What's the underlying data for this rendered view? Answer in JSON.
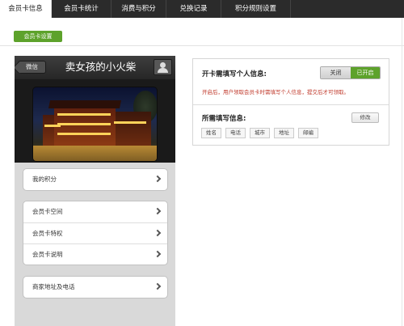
{
  "nav": {
    "tabs": [
      {
        "label": "会员卡信息",
        "active": true
      },
      {
        "label": "会员卡统计"
      },
      {
        "label": "消费与积分"
      },
      {
        "label": "兑换记录"
      },
      {
        "label": "积分规则设置"
      }
    ]
  },
  "subnav": {
    "button_label": "会员卡设置"
  },
  "preview": {
    "back_label": "微信",
    "title": "卖女孩的小火柴",
    "user_icon": "user-icon",
    "menu_groups": [
      [
        "我的积分"
      ],
      [
        "会员卡空间",
        "会员卡特权",
        "会员卡说明"
      ],
      [
        "商家地址及电话"
      ]
    ]
  },
  "settings": {
    "require_info_label": "开卡需填写个人信息:",
    "toggle_off_label": "关闭",
    "toggle_on_label": "已开启",
    "toggle_state": "on",
    "hint": "开启后，用户领取会员卡时需填写个人信息，提交后才可领取。",
    "fields_label": "所需填写信息:",
    "edit_label": "修改",
    "fields": [
      "姓名",
      "电话",
      "城市",
      "地址",
      "邮编"
    ]
  },
  "colors": {
    "accent_green": "#5da22b",
    "nav_bg": "#2b2b2b",
    "hint_red": "#c0392b"
  }
}
